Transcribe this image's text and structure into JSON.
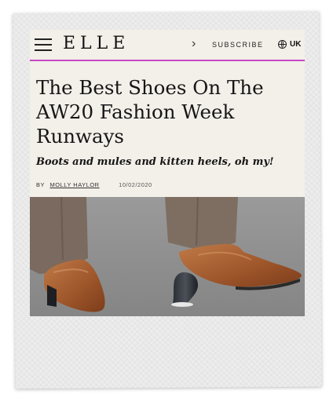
{
  "header": {
    "logo": "ELLE",
    "chevron": "›",
    "subscribe_label": "SUBSCRIBE",
    "region_label": "UK",
    "accent_color": "#c548c7"
  },
  "article": {
    "title": "The Best Shoes On The AW20 Fashion Week Runways",
    "subtitle": "Boots and mules and kitten heels, oh my!",
    "by_label": "BY",
    "author": "MOLLY HAYLOR",
    "date": "10/02/2020"
  },
  "icons": [
    "menu-icon",
    "chevron-right-icon",
    "globe-icon"
  ]
}
